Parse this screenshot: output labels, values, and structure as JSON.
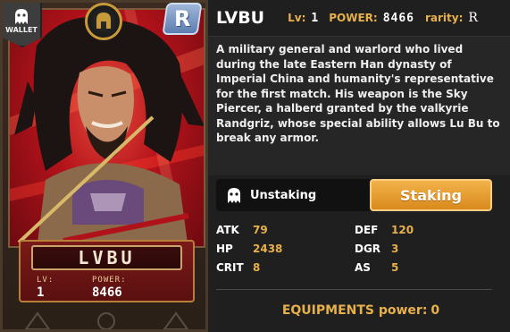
{
  "card": {
    "wallet_label": "WALLET",
    "rarity_letter": "R",
    "name": "LVBU",
    "lv_label": "LV:",
    "lv_value": "1",
    "power_label": "POWER:",
    "power_value": "8466"
  },
  "header": {
    "hero_name": "LVBU",
    "lv_label": "Lv:",
    "lv_value": "1",
    "power_label": "POWER:",
    "power_value": "8466",
    "rarity_label": "rarity:",
    "rarity_value": "R"
  },
  "description": "A military general and warlord who lived during the late Eastern Han dynasty of Imperial China and humanity's representative for the first match. His weapon is the Sky Piercer, a halberd granted by the valkyrie Randgriz, whose special ability allows Lu Bu to break any armor.",
  "toggle": {
    "unstaking_label": "Unstaking",
    "staking_label": "Staking"
  },
  "stats": {
    "atk_label": "ATK",
    "atk_value": "79",
    "def_label": "DEF",
    "def_value": "120",
    "hp_label": "HP",
    "hp_value": "2438",
    "dgr_label": "DGR",
    "dgr_value": "3",
    "crit_label": "CRIT",
    "crit_value": "8",
    "as_label": "AS",
    "as_value": "5"
  },
  "equipments": {
    "label": "EQUIPMENTS power:",
    "value": "0"
  },
  "colors": {
    "accent": "#e8b04a",
    "staking_button": "#f2b24a",
    "card_red": "#b3121a",
    "rarity_blue": "#5c7eb0"
  }
}
